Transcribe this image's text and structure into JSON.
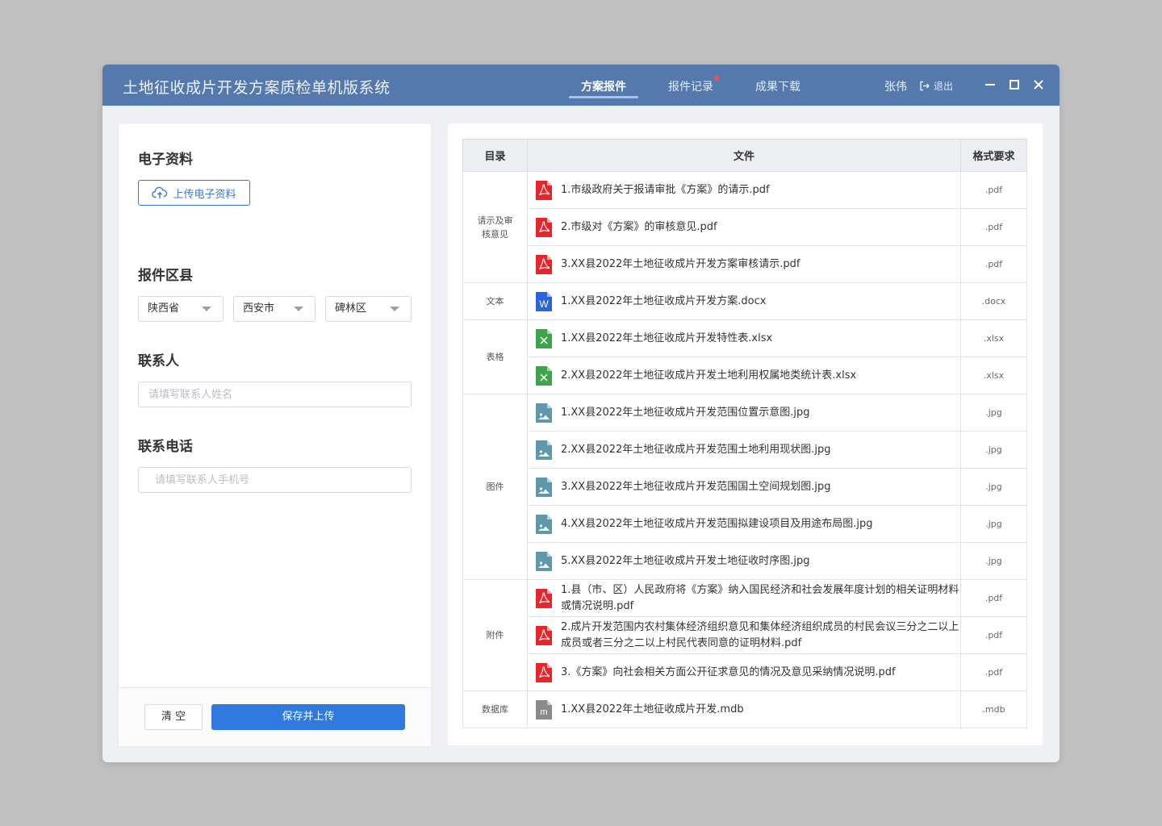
{
  "app": {
    "title": "土地征收成片开发方案质检单机版系统",
    "user_name": "张伟",
    "logout_label": "退出"
  },
  "nav": {
    "tabs": [
      {
        "label": "方案报件",
        "active": true
      },
      {
        "label": "报件记录",
        "has_notification": true
      },
      {
        "label": "成果下载"
      }
    ]
  },
  "left": {
    "e_docs_title": "电子资料",
    "upload_label": "上传电子资料",
    "region_title": "报件区县",
    "province": "陕西省",
    "city": "西安市",
    "district": "碑林区",
    "contact_title": "联系人",
    "contact_placeholder": "请填写联系人姓名",
    "phone_title": "联系电话",
    "phone_placeholder": "请填写联系人手机号",
    "clear_label": "清 空",
    "save_label": "保存并上传"
  },
  "table": {
    "headers": [
      "目录",
      "文件",
      "格式要求"
    ],
    "groups": [
      {
        "category": "请示及审核意见",
        "rows": [
          {
            "icon": "pdf-icon",
            "file": "1.市级政府关于报请审批《方案》的请示.pdf",
            "format": ".pdf"
          },
          {
            "icon": "pdf-icon",
            "file": "2.市级对《方案》的审核意见.pdf",
            "format": ".pdf"
          },
          {
            "icon": "pdf-icon",
            "file": "3.XX县2022年土地征收成片开发方案审核请示.pdf",
            "format": ".pdf"
          }
        ]
      },
      {
        "category": "文本",
        "rows": [
          {
            "icon": "word-icon",
            "file": "1.XX县2022年土地征收成片开发方案.docx",
            "format": ".docx"
          }
        ]
      },
      {
        "category": "表格",
        "rows": [
          {
            "icon": "excel-icon",
            "file": "1.XX县2022年土地征收成片开发特性表.xlsx",
            "format": ".xlsx"
          },
          {
            "icon": "excel-icon",
            "file": "2.XX县2022年土地征收成片开发土地利用权属地类统计表.xlsx",
            "format": ".xlsx"
          }
        ]
      },
      {
        "category": "图件",
        "rows": [
          {
            "icon": "image-icon",
            "file": "1.XX县2022年土地征收成片开发范围位置示意图.jpg",
            "format": ".jpg"
          },
          {
            "icon": "image-icon",
            "file": "2.XX县2022年土地征收成片开发范围土地利用现状图.jpg",
            "format": ".jpg"
          },
          {
            "icon": "image-icon",
            "file": "3.XX县2022年土地征收成片开发范围国土空间规划图.jpg",
            "format": ".jpg"
          },
          {
            "icon": "image-icon",
            "file": "4.XX县2022年土地征收成片开发范围拟建设项目及用途布局图.jpg",
            "format": ".jpg"
          },
          {
            "icon": "image-icon",
            "file": "5.XX县2022年土地征收成片开发土地征收时序图.jpg",
            "format": ".jpg"
          }
        ]
      },
      {
        "category": "附件",
        "rows": [
          {
            "icon": "pdf-icon",
            "file": "1.县（市、区）人民政府将《方案》纳入国民经济和社会发展年度计划的相关证明材料或情况说明.pdf",
            "format": ".pdf"
          },
          {
            "icon": "pdf-icon",
            "file": "2.成片开发范围内农村集体经济组织意见和集体经济组织成员的村民会议三分之二以上成员或者三分之二以上村民代表同意的证明材料.pdf",
            "format": ".pdf"
          },
          {
            "icon": "pdf-icon",
            "file": "3.《方案》向社会相关方面公开征求意见的情况及意见采纳情况说明.pdf",
            "format": ".pdf"
          }
        ]
      },
      {
        "category": "数据库",
        "rows": [
          {
            "icon": "mdb-icon",
            "file": "1.XX县2022年土地征收成片开发.mdb",
            "format": ".mdb"
          }
        ]
      }
    ]
  },
  "colors": {
    "titlebar": "#5578ad",
    "primary": "#2f79df",
    "pdf": "#e8252b",
    "word": "#2b63d9",
    "excel": "#3ea34a",
    "image": "#5f97ab",
    "mdb": "#8a8a8a"
  }
}
